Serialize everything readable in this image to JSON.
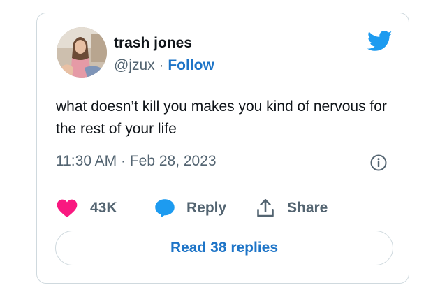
{
  "tweet": {
    "author_name": "trash jones",
    "handle": "@jzux",
    "separator": " · ",
    "follow_label": "Follow",
    "text": "what doesn’t kill you makes you kind of nervous for the rest of your life",
    "timestamp": "11:30 AM · Feb 28, 2023"
  },
  "actions": {
    "like_count": "43K",
    "reply_label": "Reply",
    "share_label": "Share"
  },
  "read_replies_label": "Read 38 replies",
  "colors": {
    "like": "#f91880",
    "reply": "#1d9bf0",
    "link": "#1d74c7",
    "bird": "#1d9bf0"
  },
  "icons": {
    "brand": "twitter-bird-icon",
    "info": "info-icon",
    "like": "heart-icon",
    "reply": "speech-bubble-icon",
    "share": "share-upload-icon"
  }
}
